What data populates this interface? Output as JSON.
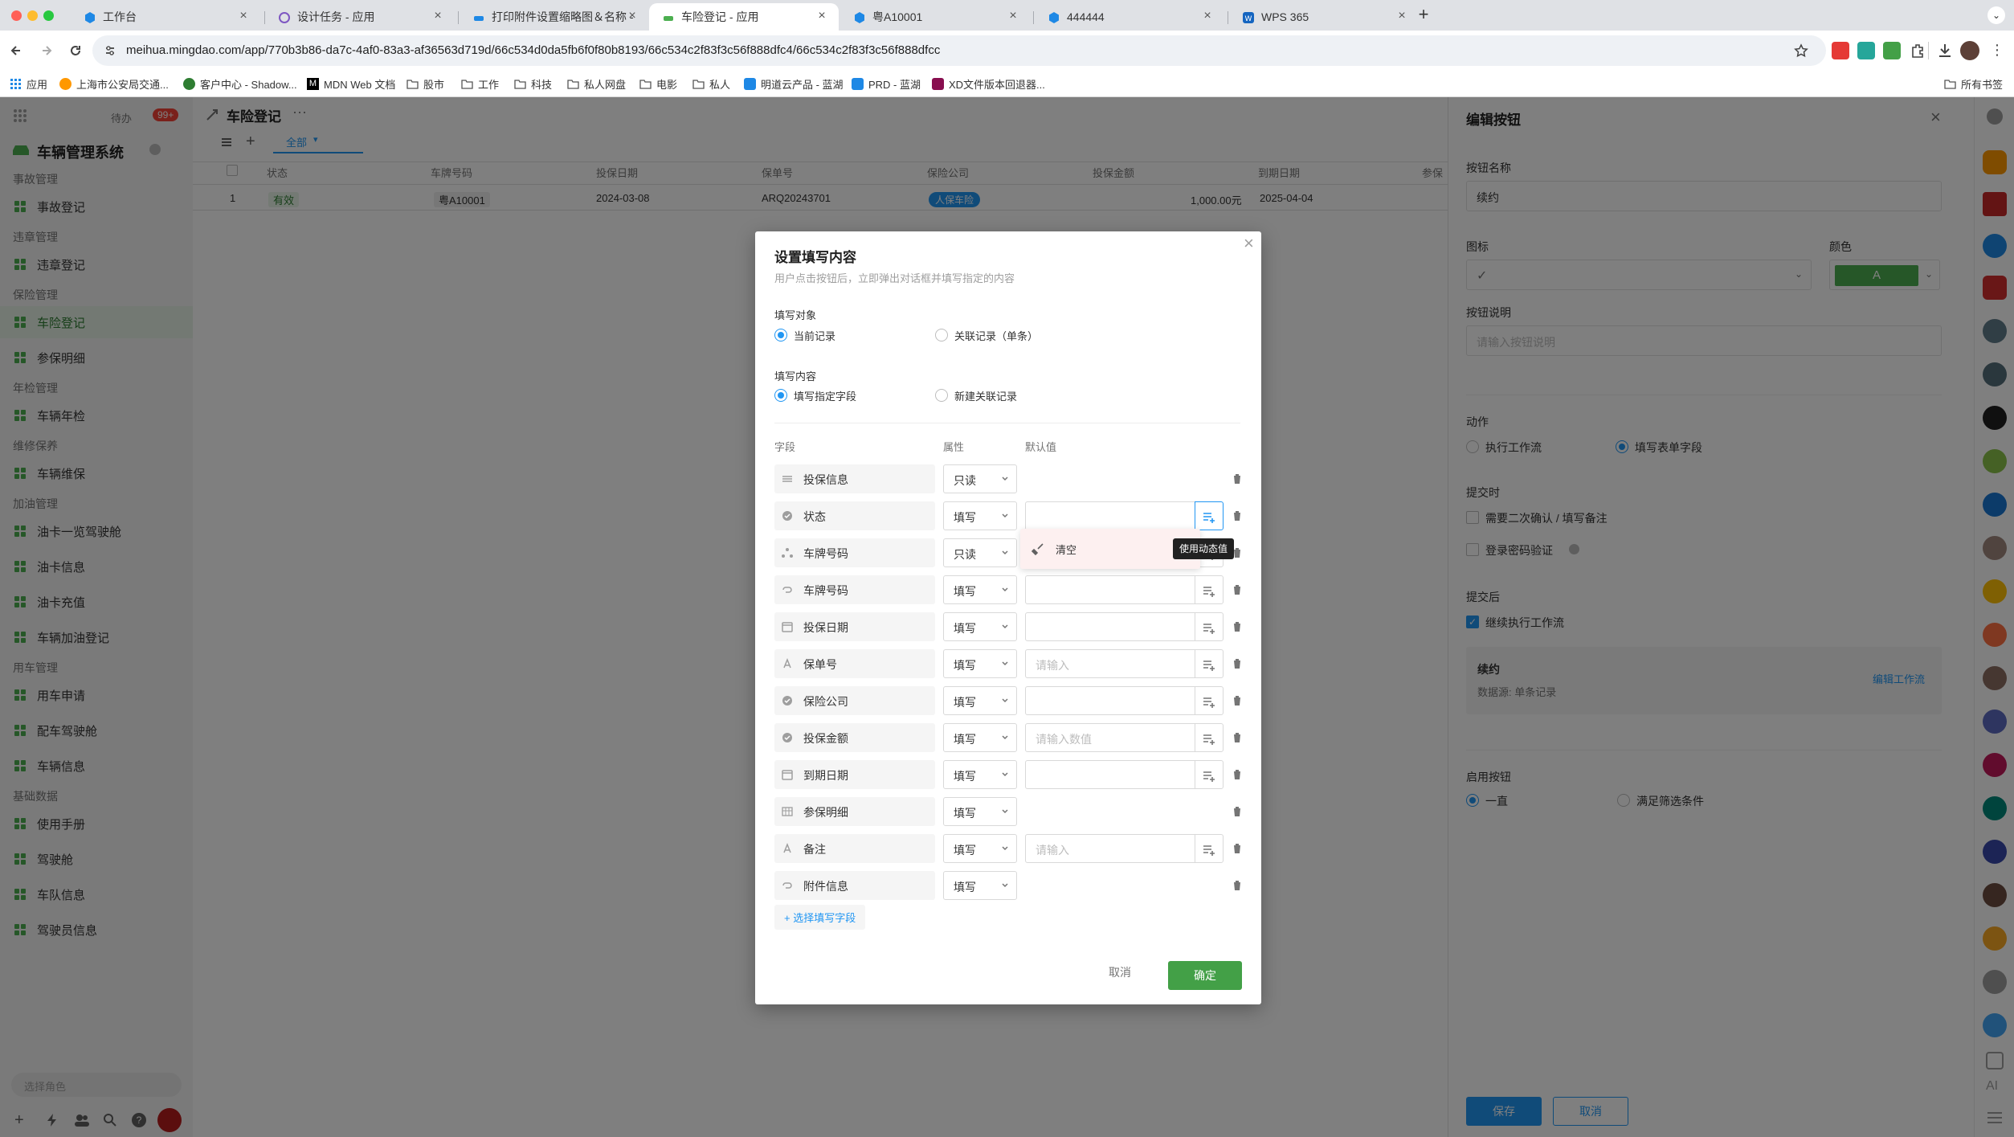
{
  "browser": {
    "tabs": [
      {
        "title": "工作台"
      },
      {
        "title": "设计任务 - 应用"
      },
      {
        "title": "打印附件设置缩略图＆名称 - E"
      },
      {
        "title": "车险登记 - 应用"
      },
      {
        "title": "粤A10001"
      },
      {
        "title": "444444"
      },
      {
        "title": "WPS 365"
      }
    ],
    "url": "meihua.mingdao.com/app/770b3b86-da7c-4af0-83a3-af36563d719d/66c534d0da5fb6f0f80b8193/66c534c2f83f3c56f888dfc4/66c534c2f83f3c56f888dfcc",
    "bookmarks": [
      "应用",
      "上海市公安局交通...",
      "客户中心 - Shadow...",
      "MDN Web 文档",
      "股市",
      "工作",
      "科技",
      "私人网盘",
      "电影",
      "私人",
      "明道云产品 - 蓝湖",
      "PRD - 蓝湖",
      "XD文件版本回退器..."
    ],
    "all_bookmarks": "所有书签"
  },
  "sidebar": {
    "todo_label": "待办",
    "todo_badge": "99+",
    "app_name": "车辆管理系统",
    "groups": [
      {
        "title": "事故管理",
        "items": [
          "事故登记"
        ]
      },
      {
        "title": "违章管理",
        "items": [
          "违章登记"
        ]
      },
      {
        "title": "保险管理",
        "items": [
          "车险登记",
          "参保明细"
        ]
      },
      {
        "title": "年检管理",
        "items": [
          "车辆年检"
        ]
      },
      {
        "title": "维修保养",
        "items": [
          "车辆维保"
        ]
      },
      {
        "title": "加油管理",
        "items": [
          "油卡一览驾驶舱",
          "油卡信息",
          "油卡充值",
          "车辆加油登记"
        ]
      },
      {
        "title": "用车管理",
        "items": [
          "用车申请",
          "配车驾驶舱",
          "车辆信息"
        ]
      },
      {
        "title": "基础数据",
        "items": [
          "使用手册",
          "驾驶舱",
          "车队信息",
          "驾驶员信息"
        ]
      }
    ],
    "role_select": "选择角色"
  },
  "main": {
    "title": "车险登记",
    "view_tab": "全部",
    "columns": [
      "状态",
      "车牌号码",
      "投保日期",
      "保单号",
      "保险公司",
      "投保金额",
      "到期日期",
      "参保"
    ],
    "row": {
      "num": "1",
      "status": "有效",
      "plate": "粤A10001",
      "date": "2024-03-08",
      "policy": "ARQ20243701",
      "company": "人保车险",
      "amount": "1,000.00元",
      "expire": "2025-04-04"
    }
  },
  "right_panel": {
    "title": "编辑按钮",
    "name_label": "按钮名称",
    "name_value": "续约",
    "icon_label": "图标",
    "color_label": "颜色",
    "color_letter": "A",
    "desc_label": "按钮说明",
    "desc_placeholder": "请输入按钮说明",
    "action_label": "动作",
    "action_opt1": "执行工作流",
    "action_opt2": "填写表单字段",
    "submit_label": "提交时",
    "submit_opt1": "需要二次确认 / 填写备注",
    "submit_opt2": "登录密码验证",
    "after_label": "提交后",
    "after_opt": "继续执行工作流",
    "wf_name": "续约",
    "wf_source": "数据源: 单条记录",
    "wf_edit": "编辑工作流",
    "enable_label": "启用按钮",
    "enable_opt1": "一直",
    "enable_opt2": "满足筛选条件",
    "save": "保存",
    "cancel": "取消",
    "accent": "#2196f3",
    "green": "#4caf50"
  },
  "dialog": {
    "title": "设置填写内容",
    "subtitle": "用户点击按钮后，立即弹出对话框并填写指定的内容",
    "target_label": "填写对象",
    "target_opt1": "当前记录",
    "target_opt2": "关联记录（单条）",
    "content_label": "填写内容",
    "content_opt1": "填写指定字段",
    "content_opt2": "新建关联记录",
    "col_field": "字段",
    "col_attr": "属性",
    "col_default": "默认值",
    "fields": [
      {
        "name": "投保信息",
        "attr": "只读",
        "value": "",
        "icon": "divider-icon"
      },
      {
        "name": "状态",
        "attr": "填写",
        "value": "",
        "icon": "option-icon"
      },
      {
        "name": "车牌号码",
        "attr": "只读",
        "value": "",
        "icon": "relation-icon"
      },
      {
        "name": "车牌号码",
        "attr": "填写",
        "value": "",
        "icon": "link-icon"
      },
      {
        "name": "投保日期",
        "attr": "填写",
        "value": "",
        "icon": "calendar-icon"
      },
      {
        "name": "保单号",
        "attr": "填写",
        "value": "请输入",
        "icon": "text-icon"
      },
      {
        "name": "保险公司",
        "attr": "填写",
        "value": "",
        "icon": "option-icon"
      },
      {
        "name": "投保金额",
        "attr": "填写",
        "value": "请输入数值",
        "icon": "option-icon"
      },
      {
        "name": "到期日期",
        "attr": "填写",
        "value": "",
        "icon": "calendar-icon"
      },
      {
        "name": "参保明细",
        "attr": "填写",
        "value": "",
        "icon": "table-icon"
      },
      {
        "name": "备注",
        "attr": "填写",
        "value": "请输入",
        "icon": "text-icon"
      },
      {
        "name": "附件信息",
        "attr": "填写",
        "value": "",
        "icon": "link-icon"
      }
    ],
    "popup_clear": "清空",
    "tooltip": "使用动态值",
    "add_field": "+ 选择填写字段",
    "cancel": "取消",
    "ok": "确定"
  }
}
